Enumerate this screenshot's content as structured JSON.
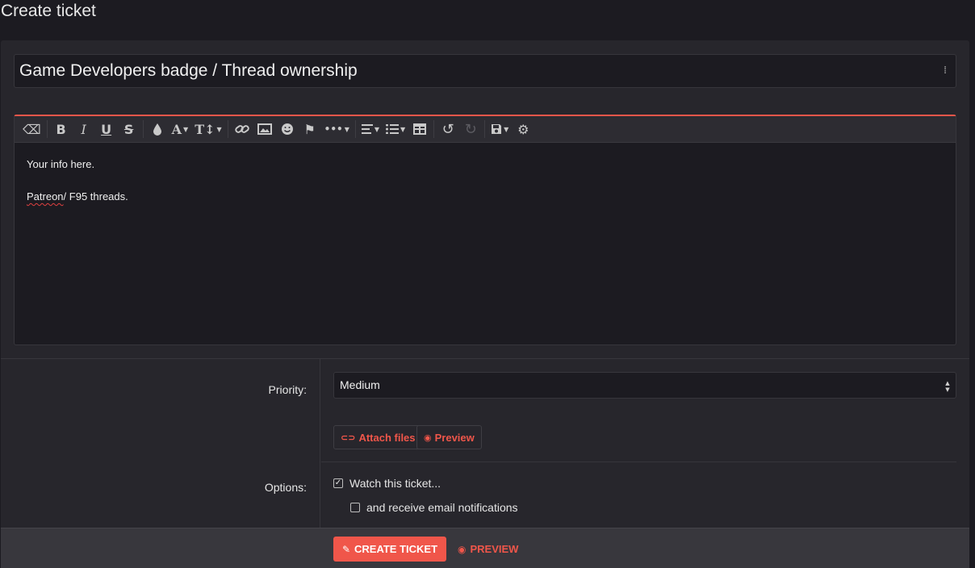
{
  "page": {
    "title": "Create ticket"
  },
  "ticket": {
    "title_value": "Game Developers badge / Thread ownership"
  },
  "editor": {
    "toolbar": [
      {
        "name": "clear-formatting",
        "glyph": "⌫"
      },
      {
        "name": "bold",
        "glyph": "B"
      },
      {
        "name": "italic",
        "glyph": "I"
      },
      {
        "name": "underline",
        "glyph": "U"
      },
      {
        "name": "strikethrough",
        "glyph": "S"
      },
      {
        "name": "text-color",
        "glyph": "💧"
      },
      {
        "name": "font-family",
        "glyph": "A"
      },
      {
        "name": "font-size",
        "glyph": "T↕"
      },
      {
        "name": "insert-link",
        "glyph": "🔗"
      },
      {
        "name": "insert-image",
        "glyph": "▨"
      },
      {
        "name": "insert-smilie",
        "glyph": "☻"
      },
      {
        "name": "insert-flag",
        "glyph": "⚑"
      },
      {
        "name": "more-options",
        "glyph": "•••"
      },
      {
        "name": "align",
        "glyph": "≡"
      },
      {
        "name": "list",
        "glyph": "☰"
      },
      {
        "name": "insert-table",
        "glyph": "⊞"
      },
      {
        "name": "undo",
        "glyph": "↺"
      },
      {
        "name": "redo",
        "glyph": "↻"
      },
      {
        "name": "drafts",
        "glyph": "💾"
      },
      {
        "name": "settings",
        "glyph": "⚙"
      }
    ],
    "content": {
      "line1": "Your info here.",
      "line2_spell": "Patreon",
      "line2_rest": "/ F95 threads."
    }
  },
  "form": {
    "priority_label": "Priority:",
    "priority_value": "Medium",
    "attach_label": "Attach files",
    "preview_label": "Preview",
    "options_label": "Options:",
    "watch_label": "Watch this ticket...",
    "email_label": "and receive email notifications"
  },
  "footer": {
    "submit_label": "CREATE TICKET",
    "preview_label": "PREVIEW"
  },
  "colors": {
    "accent": "#f0564a",
    "background": "#1c1b21",
    "panel": "#27262c"
  }
}
